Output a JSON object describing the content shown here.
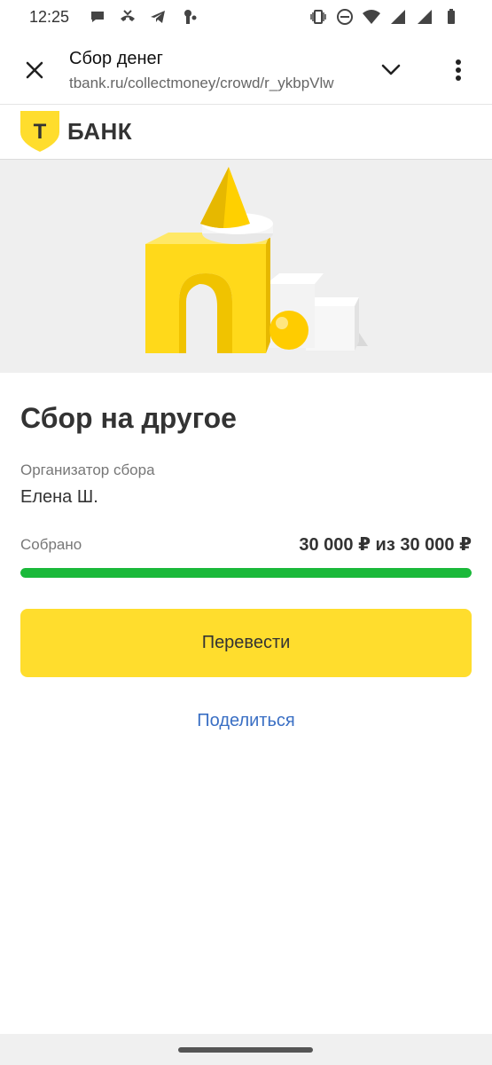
{
  "status_bar": {
    "time": "12:25",
    "left_icons": [
      "chat-bubble-icon",
      "missed-call-icon",
      "telegram-icon",
      "key-icon",
      "dot-icon"
    ],
    "right_icons": [
      "vibrate-icon",
      "do-not-disturb-icon",
      "wifi-icon",
      "signal-icon",
      "signal-icon-2",
      "battery-icon"
    ]
  },
  "browser": {
    "title": "Сбор денег",
    "url": "tbank.ru/collectmoney/crowd/r_ykbpVlw",
    "close_icon": "close-icon",
    "chevron_icon": "chevron-down-icon",
    "menu_icon": "more-vert-icon"
  },
  "bank": {
    "logo_letter": "Т",
    "name": "БАНК",
    "brand_color": "#ffdd2d"
  },
  "collection": {
    "title": "Сбор на другое",
    "organizer_label": "Организатор сбора",
    "organizer_name": "Елена Ш.",
    "collected_label": "Собрано",
    "collected_amount": "30 000 ₽ из 30 000 ₽",
    "progress_percent": 100,
    "progress_color": "#1ab93a"
  },
  "actions": {
    "transfer_label": "Перевести",
    "share_label": "Поделиться"
  }
}
